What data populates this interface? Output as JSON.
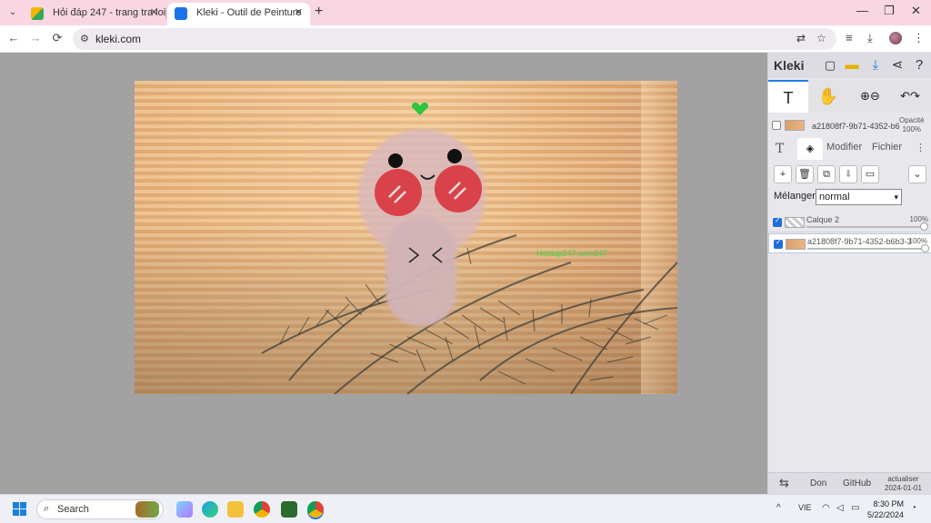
{
  "browser": {
    "tabs": [
      {
        "title": "Hỏi đáp 247 - trang tra loi",
        "favicon_color": "#f4b400"
      },
      {
        "title": "Kleki - Outil de Peinture",
        "favicon_color": "#1a73e8"
      }
    ],
    "new_tab_glyph": "+",
    "close_glyph": "✕",
    "window_controls": {
      "minimize": "—",
      "maximize": "❐",
      "close": "✕"
    },
    "nav": {
      "back": "←",
      "forward": "→",
      "reload": "⟳"
    },
    "url": "kleki.com",
    "accent_color": "#f8d7e3"
  },
  "canvas": {
    "watermark_text": "Hoidap247.com247",
    "icons": [
      "heart-icon"
    ]
  },
  "sidebar": {
    "logo": "Kleki",
    "top_icons": [
      "new-image-icon",
      "open-folder-icon",
      "download-icon",
      "share-icon",
      "help-icon"
    ],
    "tools": [
      "T",
      "✋",
      "⊕⊖",
      "↶↷"
    ],
    "active_layer_strip": {
      "name": "a21808f7-9b71-4352-b6",
      "opacity_label": "Opacité",
      "opacity_value": "100%"
    },
    "subtabs": {
      "text": "T",
      "modify": "Modifier",
      "file": "Fichier",
      "more": "⋮"
    },
    "layer_buttons": [
      "+",
      "🗑",
      "⧉",
      "⬇",
      "▭",
      "⌄"
    ],
    "blend_label": "Mélanger",
    "blend_value": "normal",
    "layers": [
      {
        "name": "Calque 2",
        "opacity": "100%",
        "checked": true
      },
      {
        "name": "a21808f7-9b71-4352-b6b3-3",
        "opacity": "100%",
        "checked": true
      }
    ],
    "bottom": {
      "swap": "⇆",
      "donate": "Don",
      "github": "GitHub",
      "update_label": "actualiser",
      "update_date": "2024-01-01"
    }
  },
  "taskbar": {
    "search_placeholder": "Search",
    "language": "VIE",
    "time": "8:30 PM",
    "date": "5/22/2024"
  }
}
